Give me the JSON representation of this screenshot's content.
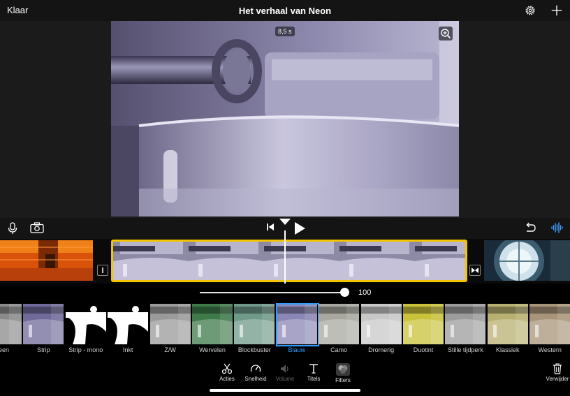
{
  "header": {
    "done_label": "Klaar",
    "title": "Het verhaal van Neon",
    "settings_icon": "gear-icon",
    "add_icon": "plus-icon"
  },
  "preview": {
    "duration_badge": "8,5 s",
    "zoom_icon": "zoom-in-icon"
  },
  "controls": {
    "mic_icon": "microphone-icon",
    "camera_icon": "camera-icon",
    "skip_icon": "skip-to-start-icon",
    "play_icon": "play-icon",
    "undo_icon": "undo-icon",
    "audio_icon": "audio-waveform-icon"
  },
  "filter_slider": {
    "value": "100",
    "fraction": 1.0
  },
  "filters": [
    {
      "label": "Geen",
      "tone": "#8a8a8a"
    },
    {
      "label": "Strip",
      "tone": "#6f6a9a"
    },
    {
      "label": "Strip - mono",
      "tone": "#d9d9d9"
    },
    {
      "label": "Inkt",
      "tone": "#f2f2f2"
    },
    {
      "label": "Z/W",
      "tone": "#9a9a9a"
    },
    {
      "label": "Wervelen",
      "tone": "#3e7a4a"
    },
    {
      "label": "Blockbuster",
      "tone": "#6f9a8a"
    },
    {
      "label": "Blauw",
      "tone": "#8a86b6",
      "selected": true
    },
    {
      "label": "Camo",
      "tone": "#a8a8a0"
    },
    {
      "label": "Dromerig",
      "tone": "#c8c8c8"
    },
    {
      "label": "Duotint",
      "tone": "#c9c23a"
    },
    {
      "label": "Stille tijdperk",
      "tone": "#9c9c9c"
    },
    {
      "label": "Klassiek",
      "tone": "#b8b070"
    },
    {
      "label": "Western",
      "tone": "#a89478"
    }
  ],
  "toolbar": {
    "actions": "Acties",
    "speed": "Snelheid",
    "volume": "Volume",
    "titles": "Titels",
    "filters": "Filters",
    "delete": "Verwijder"
  },
  "colors": {
    "selection_yellow": "#f5c400",
    "accent_blue": "#2f9bff"
  }
}
